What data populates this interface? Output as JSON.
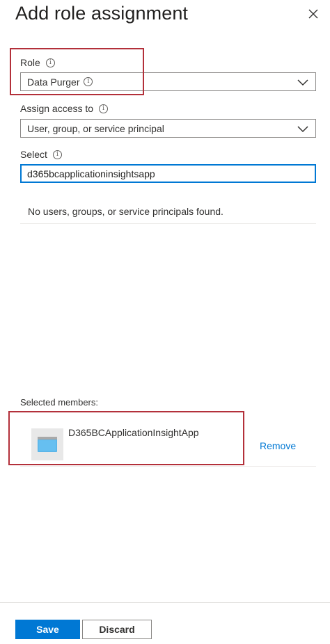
{
  "panel": {
    "title": "Add role assignment"
  },
  "role": {
    "label": "Role",
    "value": "Data Purger"
  },
  "assign_access": {
    "label": "Assign access to",
    "value": "User, group, or service principal"
  },
  "select": {
    "label": "Select",
    "value": "d365bcapplicationinsightsapp",
    "empty_message": "No users, groups, or service principals found."
  },
  "selected_members": {
    "label": "Selected members:",
    "items": [
      {
        "name": "D365BCApplicationInsightApp",
        "action": "Remove"
      }
    ]
  },
  "footer": {
    "save_label": "Save",
    "discard_label": "Discard"
  },
  "colors": {
    "accent": "#0078d4",
    "highlight": "#b3303a"
  }
}
